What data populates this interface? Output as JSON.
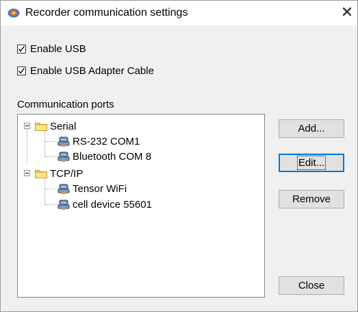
{
  "window": {
    "title": "Recorder communication settings",
    "close_glyph": "✕"
  },
  "options": {
    "enable_usb": {
      "label": "Enable USB",
      "checked": true
    },
    "enable_usb_adapter": {
      "label": "Enable USB Adapter Cable",
      "checked": true
    }
  },
  "ports": {
    "group_label": "Communication ports",
    "tree": [
      {
        "label": "Serial",
        "icon": "folder-icon",
        "children": [
          {
            "label": "RS-232 COM1",
            "icon": "device-icon"
          },
          {
            "label": "Bluetooth COM 8",
            "icon": "device-icon"
          }
        ]
      },
      {
        "label": "TCP/IP",
        "icon": "folder-icon",
        "children": [
          {
            "label": "Tensor WiFi",
            "icon": "device-icon"
          },
          {
            "label": "cell device 55601",
            "icon": "device-icon"
          }
        ]
      }
    ]
  },
  "buttons": {
    "add": "Add...",
    "edit": "Edit...",
    "remove": "Remove",
    "close": "Close"
  }
}
